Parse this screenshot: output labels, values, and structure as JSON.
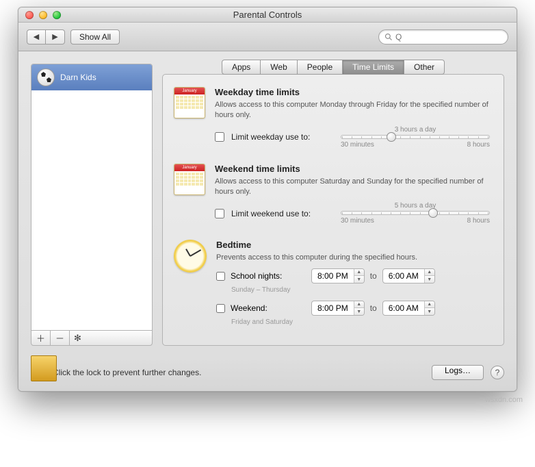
{
  "window": {
    "title": "Parental Controls"
  },
  "toolbar": {
    "show_all": "Show All",
    "search_placeholder": "Q"
  },
  "sidebar": {
    "users": [
      {
        "name": "Darn Kids"
      }
    ]
  },
  "tabs": [
    {
      "id": "apps",
      "label": "Apps"
    },
    {
      "id": "web",
      "label": "Web"
    },
    {
      "id": "people",
      "label": "People"
    },
    {
      "id": "time",
      "label": "Time Limits",
      "active": true
    },
    {
      "id": "other",
      "label": "Other"
    }
  ],
  "weekday": {
    "calendar_month": "January",
    "title": "Weekday time limits",
    "desc": "Allows access to this computer Monday through Friday for the specified number of hours only.",
    "checkbox_label": "Limit weekday use to:",
    "slider": {
      "caption": "3 hours a day",
      "min_label": "30 minutes",
      "max_label": "8 hours",
      "position_pct": 34
    }
  },
  "weekend": {
    "calendar_month": "January",
    "title": "Weekend time limits",
    "desc": "Allows access to this computer Saturday and Sunday for the specified number of hours only.",
    "checkbox_label": "Limit weekend use to:",
    "slider": {
      "caption": "5 hours a day",
      "min_label": "30 minutes",
      "max_label": "8 hours",
      "position_pct": 62
    }
  },
  "bedtime": {
    "title": "Bedtime",
    "desc": "Prevents access to this computer during the specified hours.",
    "school": {
      "label": "School nights:",
      "sub": "Sunday – Thursday",
      "from": "8:00 PM",
      "to_word": "to",
      "to": "6:00 AM"
    },
    "weekend": {
      "label": "Weekend:",
      "sub": "Friday and Saturday",
      "from": "8:00 PM",
      "to_word": "to",
      "to": "6:00 AM"
    }
  },
  "footer": {
    "lock_text": "Click the lock to prevent further changes.",
    "logs": "Logs…"
  },
  "source_watermark": "wsxdn.com"
}
